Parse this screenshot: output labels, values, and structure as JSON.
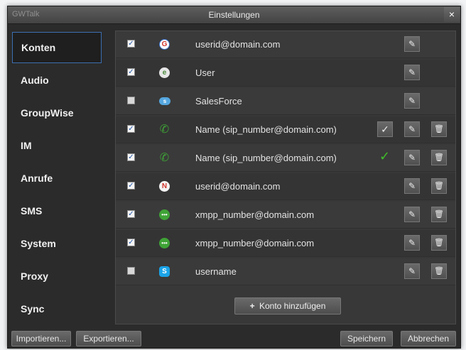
{
  "window": {
    "app_title": "GWTalk",
    "title": "Einstellungen",
    "close_glyph": "×"
  },
  "sidebar": {
    "items": [
      {
        "label": "Konten",
        "active": true
      },
      {
        "label": "Audio"
      },
      {
        "label": "GroupWise"
      },
      {
        "label": "IM"
      },
      {
        "label": "Anrufe"
      },
      {
        "label": "SMS"
      },
      {
        "label": "System"
      },
      {
        "label": "Proxy"
      },
      {
        "label": "Sync"
      }
    ]
  },
  "accounts": [
    {
      "name": "userid@domain.com",
      "enabled": true,
      "icon": "google-icon",
      "icon_glyph": "G",
      "has_delete": false,
      "status": ""
    },
    {
      "name": "User",
      "enabled": true,
      "icon": "user-icon",
      "icon_glyph": "e",
      "has_delete": false,
      "status": ""
    },
    {
      "name": "SalesForce",
      "enabled": false,
      "icon": "salesforce-icon",
      "icon_glyph": "s",
      "has_delete": false,
      "status": ""
    },
    {
      "name": "Name (sip_number@domain.com)",
      "enabled": true,
      "icon": "phone-icon",
      "icon_glyph": "✆",
      "has_delete": true,
      "status": "confirm-button"
    },
    {
      "name": "Name (sip_number@domain.com)",
      "enabled": true,
      "icon": "phone-icon",
      "icon_glyph": "✆",
      "has_delete": true,
      "status": "connected"
    },
    {
      "name": "userid@domain.com",
      "enabled": true,
      "icon": "novell-icon",
      "icon_glyph": "N",
      "has_delete": true,
      "status": ""
    },
    {
      "name": "xmpp_number@domain.com",
      "enabled": true,
      "icon": "xmpp-icon",
      "icon_glyph": "•••",
      "has_delete": true,
      "status": ""
    },
    {
      "name": "xmpp_number@domain.com",
      "enabled": true,
      "icon": "xmpp-icon",
      "icon_glyph": "•••",
      "has_delete": true,
      "status": ""
    },
    {
      "name": "username",
      "enabled": false,
      "icon": "skype-icon",
      "icon_glyph": "S",
      "has_delete": true,
      "status": ""
    }
  ],
  "glyphs": {
    "check": "✓",
    "edit": "✎",
    "delete": "🗑",
    "plus": "+"
  },
  "add_button_label": "Konto hinzufügen",
  "footer": {
    "import_label": "Importieren...",
    "export_label": "Exportieren...",
    "save_label": "Speichern",
    "cancel_label": "Abbrechen"
  },
  "colors": {
    "window_bg": "#2b2b2b",
    "accent_border": "#3d6fb1",
    "ok_green": "#3fbf2a"
  }
}
